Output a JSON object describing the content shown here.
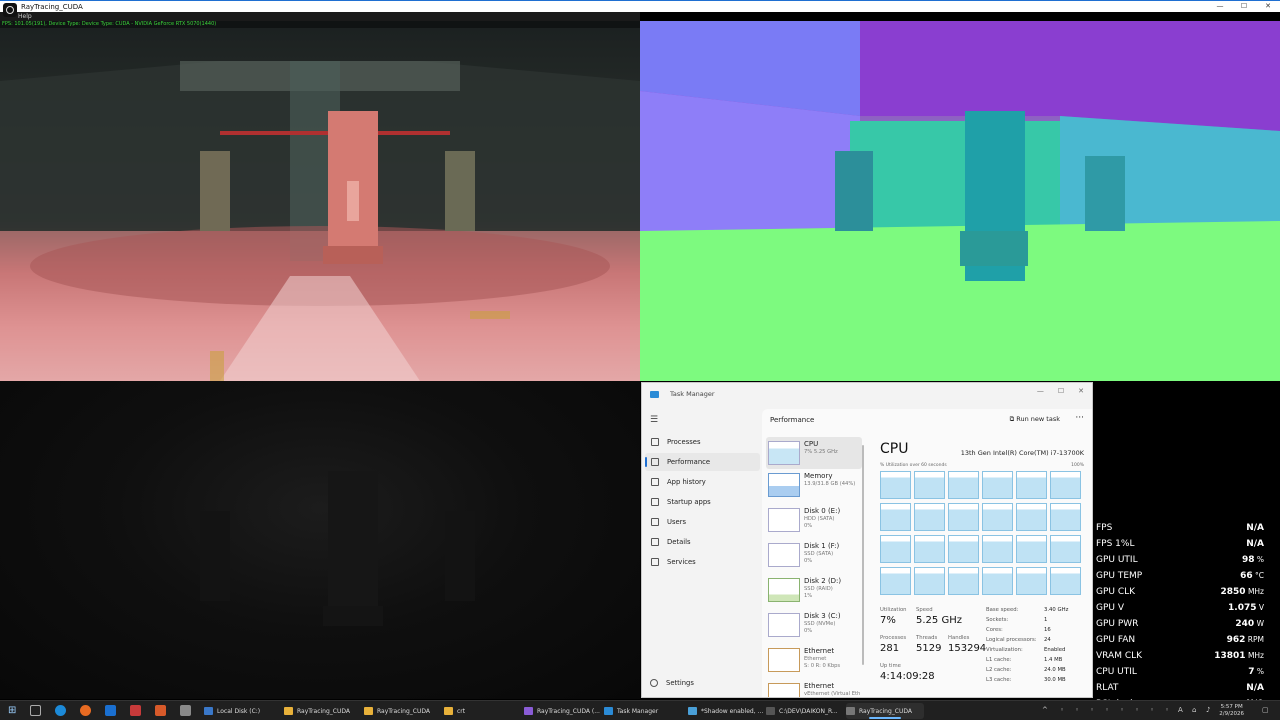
{
  "window": {
    "title": "RayTracing_CUDA",
    "menu": "Help",
    "fps_line": "FPS: 101.05(191), Device Type: Device Type: CUDA - NVIDIA GeForce RTX 5070(1440)",
    "controls": {
      "minimize": "—",
      "maximize": "☐",
      "close": "✕"
    }
  },
  "task_manager": {
    "title": "Task Manager",
    "controls": {
      "minimize": "—",
      "maximize": "☐",
      "close": "✕"
    },
    "nav": [
      {
        "label": "Processes",
        "icon": "processes-icon"
      },
      {
        "label": "Performance",
        "icon": "performance-icon",
        "active": true
      },
      {
        "label": "App history",
        "icon": "app-history-icon"
      },
      {
        "label": "Startup apps",
        "icon": "startup-apps-icon"
      },
      {
        "label": "Users",
        "icon": "users-icon"
      },
      {
        "label": "Details",
        "icon": "details-icon"
      },
      {
        "label": "Services",
        "icon": "services-icon"
      }
    ],
    "settings_label": "Settings",
    "header": {
      "title": "Performance",
      "run_new_task": "Run new task",
      "more": "···"
    },
    "resources": [
      {
        "name": "CPU",
        "sub1": "7%  5.25 GHz",
        "sub2": ""
      },
      {
        "name": "Memory",
        "sub1": "13.9/31.8 GB (44%)",
        "sub2": ""
      },
      {
        "name": "Disk 0 (E:)",
        "sub1": "HDD (SATA)",
        "sub2": "0%"
      },
      {
        "name": "Disk 1 (F:)",
        "sub1": "SSD (SATA)",
        "sub2": "0%"
      },
      {
        "name": "Disk 2 (D:)",
        "sub1": "SSD (RAID)",
        "sub2": "1%"
      },
      {
        "name": "Disk 3 (C:)",
        "sub1": "SSD (NVMe)",
        "sub2": "0%"
      },
      {
        "name": "Ethernet",
        "sub1": "Ethernet",
        "sub2": "S: 0  R: 0 Kbps"
      },
      {
        "name": "Ethernet",
        "sub1": "vEthernet (Virtual Eth",
        "sub2": ""
      }
    ],
    "cpu": {
      "title": "CPU",
      "model": "13th Gen Intel(R) Core(TM) i7-13700K",
      "util_caption": "% Utilization over 60 seconds",
      "util_max": "100%",
      "stats": {
        "utilization_label": "Utilization",
        "utilization": "7%",
        "speed_label": "Speed",
        "speed": "5.25 GHz",
        "processes_label": "Processes",
        "processes": "281",
        "threads_label": "Threads",
        "threads": "5129",
        "handles_label": "Handles",
        "handles": "153294",
        "uptime_label": "Up time",
        "uptime": "4:14:09:28"
      },
      "specs": [
        {
          "k": "Base speed:",
          "v": "3.40 GHz"
        },
        {
          "k": "Sockets:",
          "v": "1"
        },
        {
          "k": "Cores:",
          "v": "16"
        },
        {
          "k": "Logical processors:",
          "v": "24"
        },
        {
          "k": "Virtualization:",
          "v": "Enabled"
        },
        {
          "k": "L1 cache:",
          "v": "1.4 MB"
        },
        {
          "k": "L2 cache:",
          "v": "24.0 MB"
        },
        {
          "k": "L3 cache:",
          "v": "30.0 MB"
        }
      ]
    }
  },
  "overlay": [
    {
      "k": "FPS",
      "v": "N/A",
      "u": ""
    },
    {
      "k": "FPS 1%L",
      "v": "N/A",
      "u": ""
    },
    {
      "k": "GPU UTIL",
      "v": "98",
      "u": " %"
    },
    {
      "k": "GPU TEMP",
      "v": "66",
      "u": " °C"
    },
    {
      "k": "GPU CLK",
      "v": "2850",
      "u": " MHz"
    },
    {
      "k": "GPU V",
      "v": "1.075",
      "u": " V"
    },
    {
      "k": "GPU PWR",
      "v": "240",
      "u": " W"
    },
    {
      "k": "GPU FAN",
      "v": "962",
      "u": " RPM"
    },
    {
      "k": "VRAM CLK",
      "v": "13801",
      "u": " MHz"
    },
    {
      "k": "CPU UTIL",
      "v": "7",
      "u": " %"
    },
    {
      "k": "RLAT",
      "v": "N/A",
      "u": ""
    },
    {
      "k": "PCL (av)",
      "v": "N/A",
      "u": ""
    }
  ],
  "taskbar": {
    "windows": [
      {
        "label": "Local Disk (C:)",
        "icon_color": "#3a78c9"
      },
      {
        "label": "RayTracing_CUDA",
        "icon_color": "#e8b13a"
      },
      {
        "label": "RayTracing_CUDA",
        "icon_color": "#e8b13a"
      },
      {
        "label": "crt",
        "icon_color": "#e8b13a"
      },
      {
        "label": "RayTracing_CUDA (...",
        "icon_color": "#8a5cd6"
      },
      {
        "label": "Task Manager",
        "icon_color": "#2b8bd6"
      },
      {
        "label": "*Shadow enabled, ...",
        "icon_color": "#4aa0d8"
      },
      {
        "label": "C:\\DEV\\DAIKON_R...",
        "icon_color": "#555555"
      },
      {
        "label": "RayTracing_CUDA",
        "icon_color": "#777777",
        "active": true
      }
    ],
    "tray_time": "5:57 PM",
    "tray_date": "2/9/2026",
    "tray_letter": "A"
  }
}
